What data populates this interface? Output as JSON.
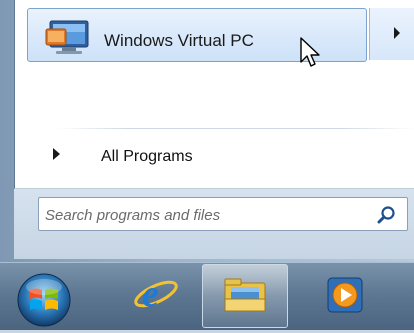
{
  "start_menu": {
    "pinned_item": {
      "label": "Windows Virtual PC",
      "icon": "virtual-pc-icon",
      "has_submenu": true
    },
    "all_programs_label": "All Programs",
    "search": {
      "placeholder": "Search programs and files",
      "icon": "search-icon"
    }
  },
  "taskbar": {
    "start_button": "windows-orb-icon",
    "buttons": [
      {
        "name": "internet-explorer",
        "icon": "ie-icon",
        "active": false
      },
      {
        "name": "windows-explorer",
        "icon": "folder-library-icon",
        "active": true
      },
      {
        "name": "windows-media-player",
        "icon": "media-player-icon",
        "active": false
      }
    ]
  },
  "colors": {
    "highlight_border": "#7da2ce",
    "highlight_fill": "#dbeafb",
    "taskbar": "#5e7893"
  }
}
